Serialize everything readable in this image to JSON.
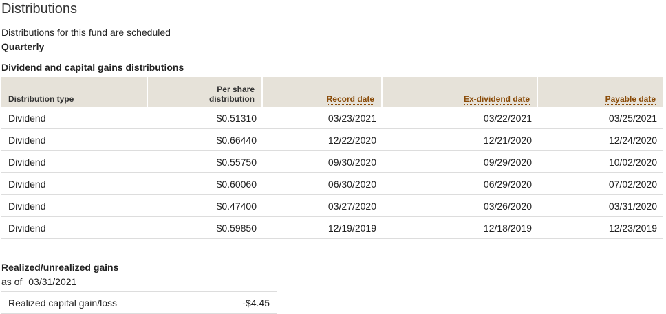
{
  "page_title": "Distributions",
  "schedule": {
    "text": "Distributions for this fund are scheduled",
    "frequency": "Quarterly"
  },
  "dividend_section": {
    "title": "Dividend and capital gains distributions",
    "headers": {
      "type": "Distribution type",
      "per_share_line1": "Per share",
      "per_share_line2": "distribution",
      "record": "Record date",
      "ex_dividend": "Ex-dividend date",
      "payable": "Payable date"
    },
    "rows": [
      {
        "type": "Dividend",
        "per_share": "$0.51310",
        "record": "03/23/2021",
        "ex_dividend": "03/22/2021",
        "payable": "03/25/2021"
      },
      {
        "type": "Dividend",
        "per_share": "$0.66440",
        "record": "12/22/2020",
        "ex_dividend": "12/21/2020",
        "payable": "12/24/2020"
      },
      {
        "type": "Dividend",
        "per_share": "$0.55750",
        "record": "09/30/2020",
        "ex_dividend": "09/29/2020",
        "payable": "10/02/2020"
      },
      {
        "type": "Dividend",
        "per_share": "$0.60060",
        "record": "06/30/2020",
        "ex_dividend": "06/29/2020",
        "payable": "07/02/2020"
      },
      {
        "type": "Dividend",
        "per_share": "$0.47400",
        "record": "03/27/2020",
        "ex_dividend": "03/26/2020",
        "payable": "03/31/2020"
      },
      {
        "type": "Dividend",
        "per_share": "$0.59850",
        "record": "12/19/2019",
        "ex_dividend": "12/18/2019",
        "payable": "12/23/2019"
      }
    ]
  },
  "gains_section": {
    "title": "Realized/unrealized gains",
    "as_of_label": "as of",
    "as_of_date": "03/31/2021",
    "rows": [
      {
        "label": "Realized capital gain/loss",
        "value": "-$4.45"
      }
    ]
  },
  "colors": {
    "header_bg": "#e6e2d9",
    "link_accent": "#8a4b08",
    "row_border": "#dddddd"
  }
}
